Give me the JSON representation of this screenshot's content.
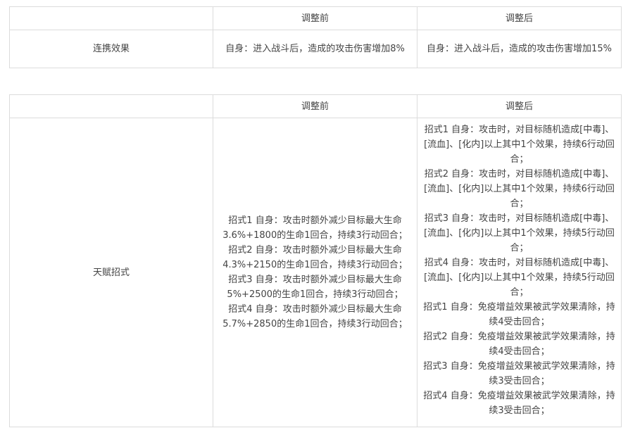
{
  "table1": {
    "headers": [
      "",
      "调整前",
      "调整后"
    ],
    "row": {
      "label": "连携效果",
      "before": "自身：进入战斗后，造成的攻击伤害增加8%",
      "after": "自身：进入战斗后，造成的攻击伤害增加15%"
    }
  },
  "table2": {
    "headers": [
      "",
      "调整前",
      "调整后"
    ],
    "row": {
      "label": "天赋招式",
      "before": [
        "招式1 自身：攻击时额外减少目标最大生命3.6%+1800的生命1回合，持续3行动回合；",
        "招式2 自身：攻击时额外减少目标最大生命4.3%+2150的生命1回合，持续3行动回合；",
        "招式3 自身：攻击时额外减少目标最大生命5%+2500的生命1回合，持续3行动回合；",
        "招式4 自身：攻击时额外减少目标最大生命5.7%+2850的生命1回合，持续3行动回合；"
      ],
      "after": [
        "招式1 自身：攻击时，对目标随机造成[中毒]、[流血]、[化内]以上其中1个效果，持续6行动回合；",
        "招式2 自身：攻击时，对目标随机造成[中毒]、[流血]、[化内]以上其中1个效果，持续6行动回合；",
        "招式3 自身：攻击时，对目标随机造成[中毒]、[流血]、[化内]以上其中1个效果，持续5行动回合；",
        "招式4 自身：攻击时，对目标随机造成[中毒]、[流血]、[化内]以上其中1个效果，持续5行动回合；",
        "招式1 自身：免疫增益效果被武学效果清除，持续4受击回合；",
        "招式2 自身：免疫增益效果被武学效果清除，持续4受击回合；",
        "招式3 自身：免疫增益效果被武学效果清除，持续3受击回合；",
        "招式4 自身：免疫增益效果被武学效果清除，持续3受击回合；"
      ]
    }
  }
}
